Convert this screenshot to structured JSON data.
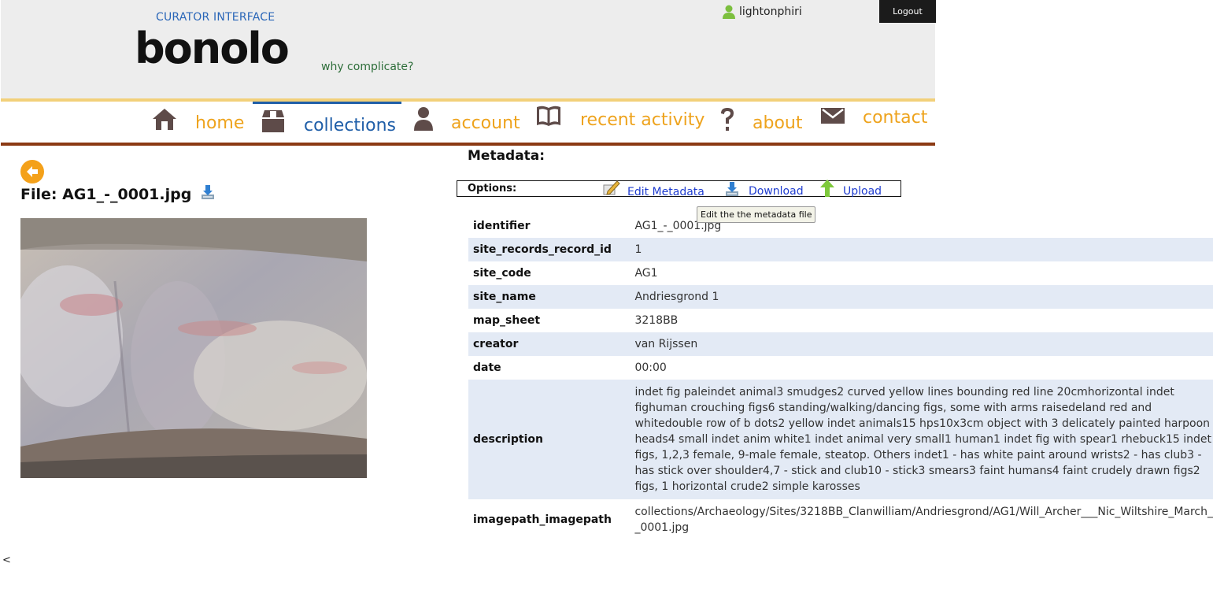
{
  "header": {
    "subtitle": "CURATOR INTERFACE",
    "brand": "bonolo",
    "tagline": "why complicate?",
    "username": "lightonphiri",
    "logout_label": "Logout"
  },
  "nav": {
    "items": [
      {
        "label": "home",
        "icon": "home-icon"
      },
      {
        "label": "collections",
        "icon": "box-icon",
        "active": true
      },
      {
        "label": "account",
        "icon": "person-icon"
      },
      {
        "label": "recent activity",
        "icon": "book-icon"
      },
      {
        "label": "about",
        "icon": "question-icon"
      },
      {
        "label": "contact",
        "icon": "envelope-icon"
      }
    ]
  },
  "file": {
    "title": "File: AG1_-_0001.jpg"
  },
  "metadata": {
    "title": "Metadata:",
    "options_label": "Options:",
    "options": [
      {
        "label": "Edit Metadata",
        "icon": "pencil-icon"
      },
      {
        "label": "Download",
        "icon": "download-icon"
      },
      {
        "label": "Upload",
        "icon": "upload-arrow-icon"
      }
    ],
    "tooltip": "Edit the the metadata file",
    "rows": [
      {
        "key": "identifier",
        "value": "AG1_-_0001.jpg"
      },
      {
        "key": "site_records_record_id",
        "value": "1"
      },
      {
        "key": "site_code",
        "value": "AG1"
      },
      {
        "key": "site_name",
        "value": "Andriesgrond 1"
      },
      {
        "key": "map_sheet",
        "value": "3218BB"
      },
      {
        "key": "creator",
        "value": "van Rijssen"
      },
      {
        "key": "date",
        "value": "00:00"
      },
      {
        "key": "description",
        "value": "indet fig paleindet animal3 smudges2 curved yellow lines bounding red line 20cmhorizontal indet fighuman crouching figs6 standing/walking/dancing figs, some with arms raisedeland red and whitedouble row of b dots2 yellow indet animals15 hps10x3cm object with 3 delicately painted harpoon heads4 small indet anim white1 indet animal very small1 human1 indet fig with spear1 rhebuck15 indet figs, 1,2,3 female, 9-male female, steatop. Others indet1 - has white paint around wrists2 - has club3 - has stick over shoulder4,7 - stick and club10 - stick3 smears3 faint humans4 faint crudely drawn figs2 figs, 1 horizontal crude2 simple karosses"
      },
      {
        "key": "imagepath_imagepath",
        "value": "collections/Archaeology/Sites/3218BB_Clanwilliam/Andriesgrond/AG1/Will_Archer___Nic_Wiltshire_March_ _0001.jpg"
      }
    ]
  },
  "footer": {
    "symbol": "<"
  }
}
